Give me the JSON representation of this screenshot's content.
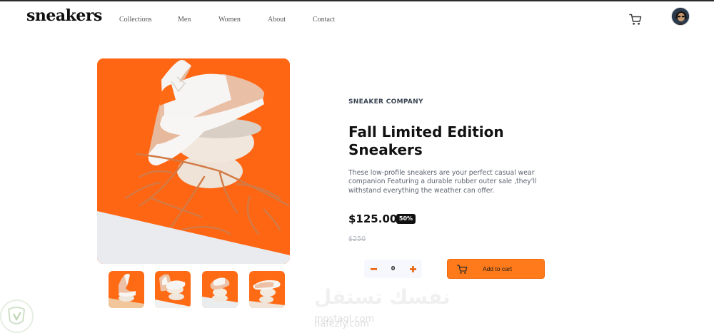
{
  "header": {
    "logo": "sneakers",
    "nav": [
      "Collections",
      "Men",
      "Women",
      "About",
      "Contact"
    ],
    "cart_icon": "cart-icon",
    "avatar_icon": "user-avatar"
  },
  "product": {
    "company": "SNEAKER COMPANY",
    "title": "Fall Limited Edition Sneakers",
    "description": "These low-profile sneakers are your perfect casual wear companion Featuring a durable rubber outer sale ,they'll withstand everything the weather can offer.",
    "price": "$125.00",
    "discount": "50%",
    "original_price": "$250",
    "quantity": "0",
    "add_to_cart": "Add to cart"
  },
  "watermark": {
    "arabic": "نفسك تستقل",
    "site1": "mostaql.com",
    "site2": "nafezly.com"
  },
  "colors": {
    "accent": "#ff7a1a",
    "image_orange": "#ff6a1a",
    "text_dark": "#1d2026",
    "text_muted": "#5d6470"
  }
}
